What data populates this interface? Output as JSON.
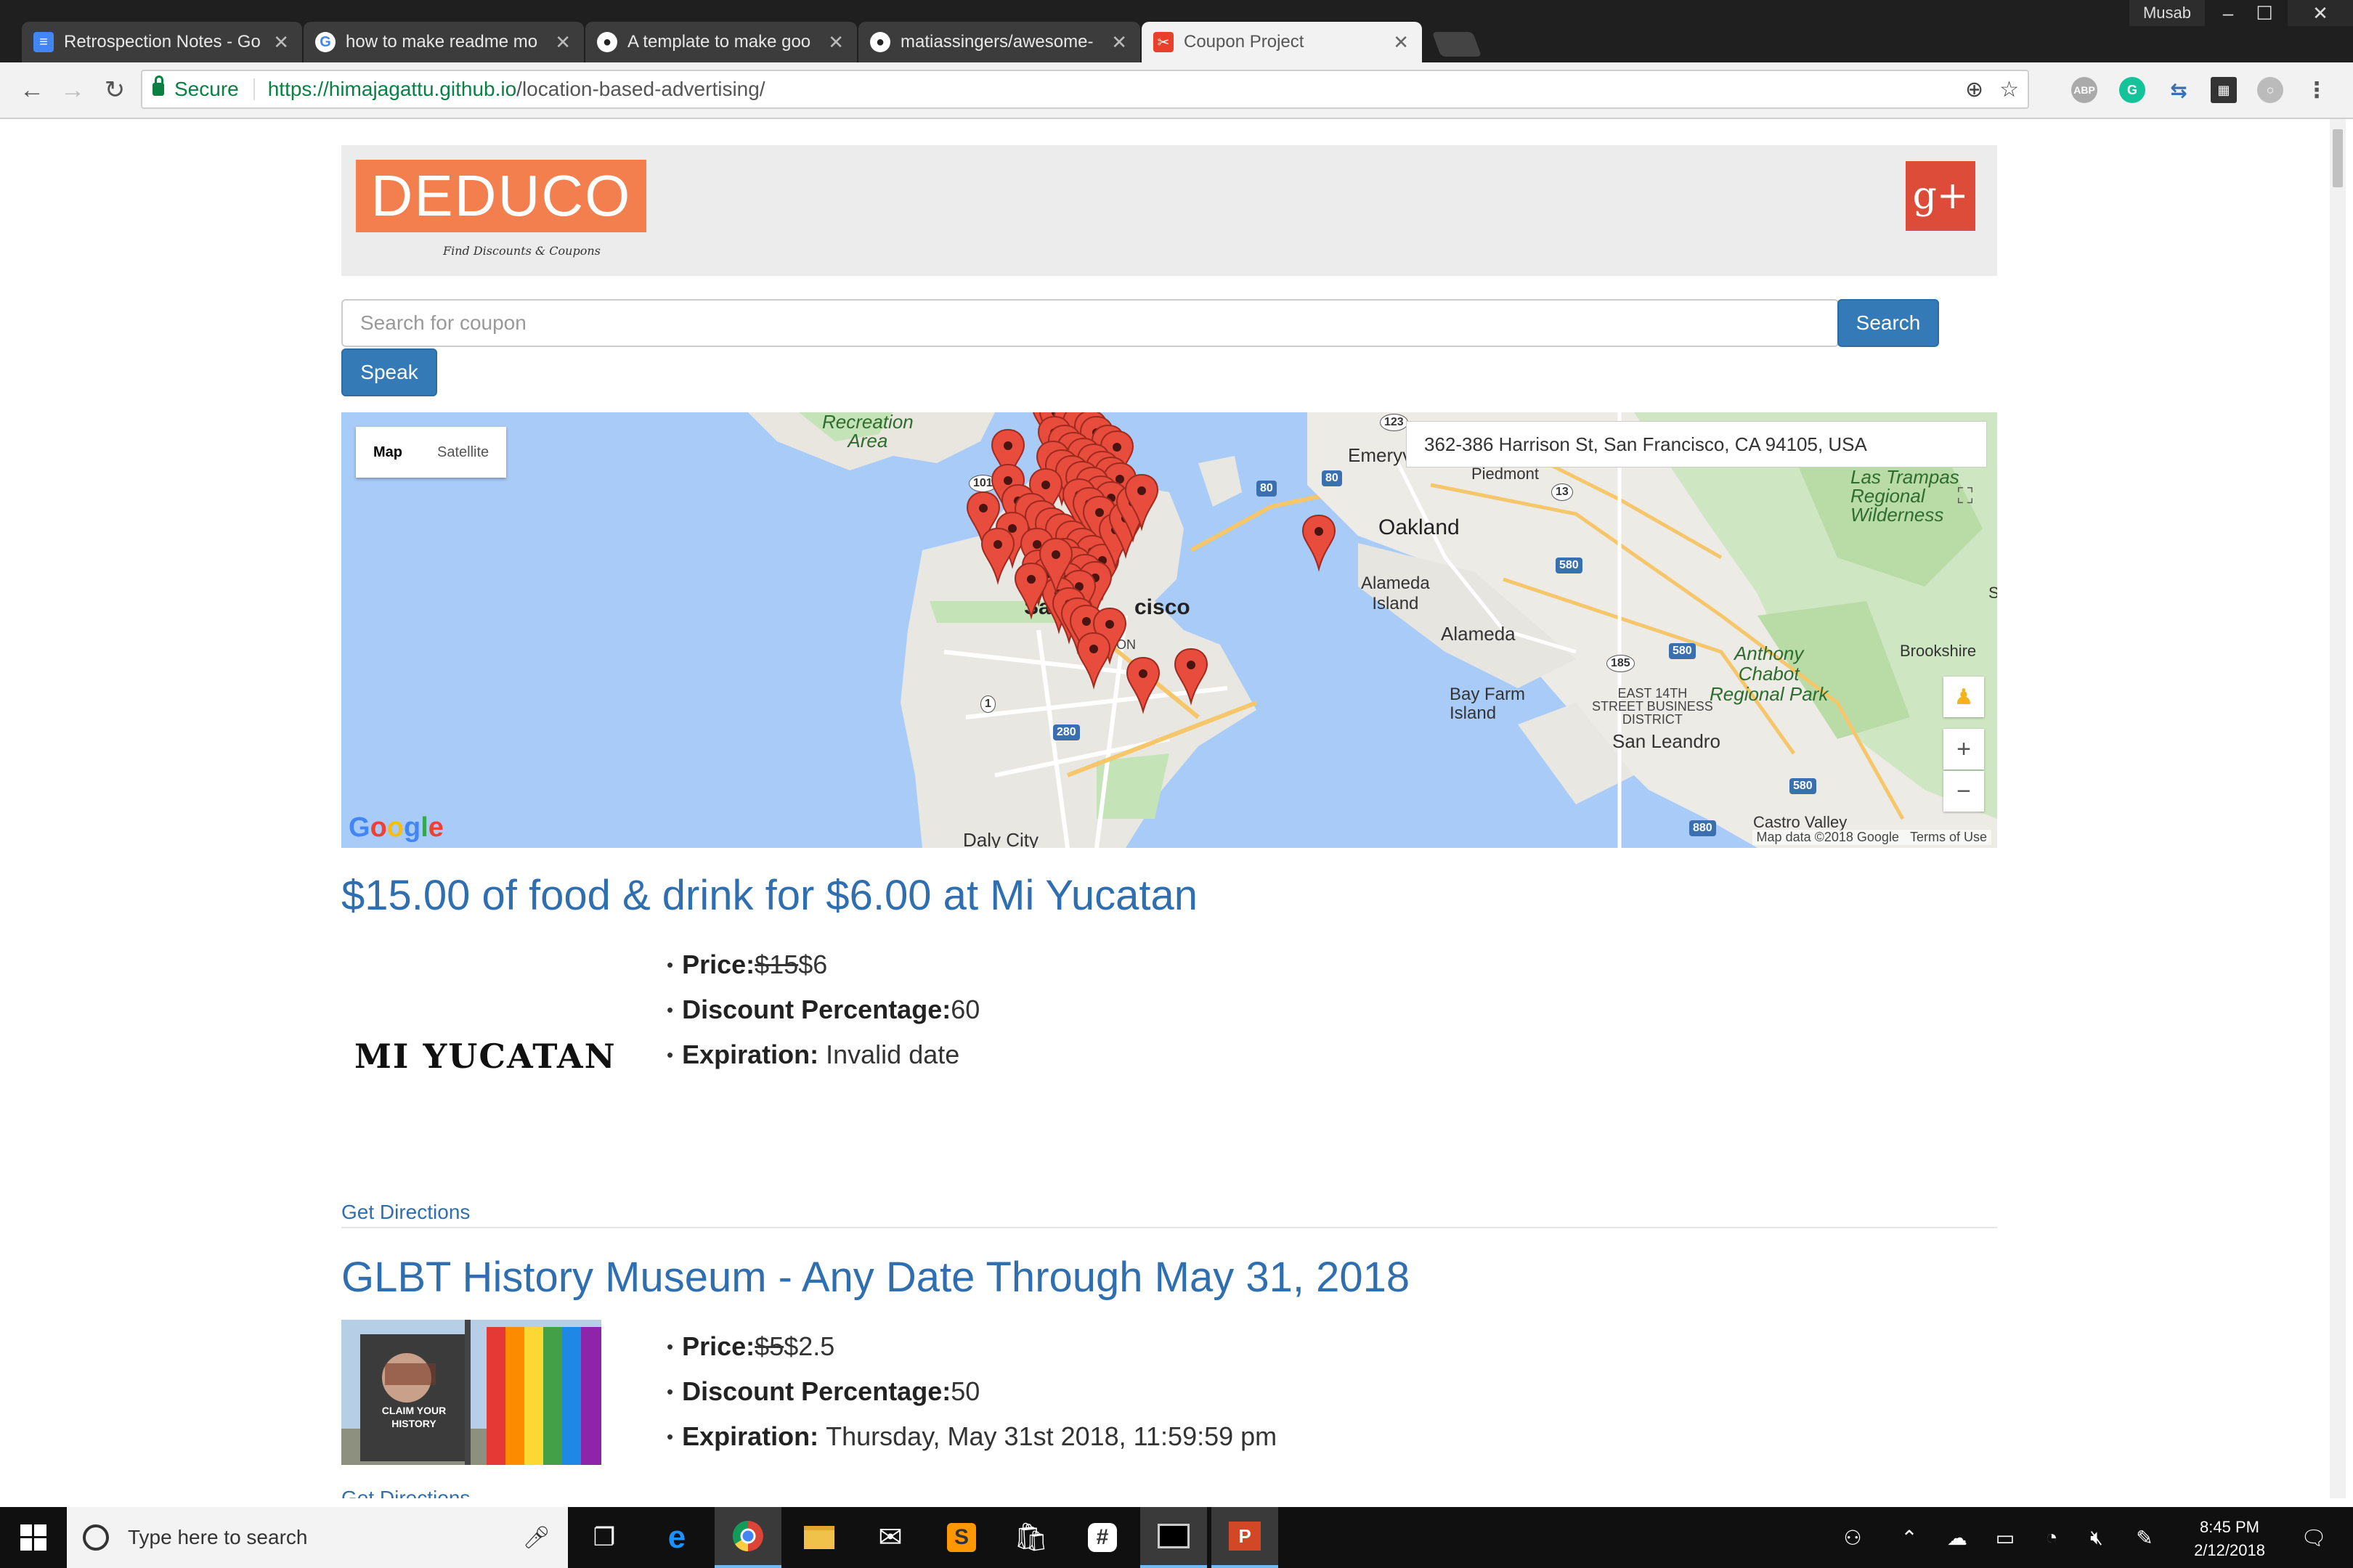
{
  "browser": {
    "user": "Musab",
    "tabs": [
      {
        "label": "Retrospection Notes - Go",
        "icon": "google-docs-icon",
        "color": "#4285f4"
      },
      {
        "label": "how to make readme mo",
        "icon": "google-icon",
        "color": "#ffffff"
      },
      {
        "label": "A template to make goo",
        "icon": "github-icon",
        "color": "#ffffff"
      },
      {
        "label": "matiassingers/awesome-",
        "icon": "github-icon",
        "color": "#ffffff"
      },
      {
        "label": "Coupon Project",
        "icon": "coupon-icon",
        "color": "#e8402b",
        "active": true
      }
    ],
    "secure_label": "Secure",
    "url_host": "https://himajagattu.github.io",
    "url_path": "/location-based-advertising/",
    "extensions": [
      "ABP",
      "G"
    ]
  },
  "page": {
    "logo_text": "DEDUCO",
    "logo_tagline": "Find Discounts & Coupons",
    "gplus_label": "g+",
    "search": {
      "placeholder": "Search for coupon",
      "button": "Search"
    },
    "speak_button": "Speak"
  },
  "map": {
    "type_map": "Map",
    "type_satellite": "Satellite",
    "address": "362-386 Harrison St, San Francisco, CA 94105, USA",
    "attribution": "Map data ©2018 Google",
    "terms": "Terms of Use",
    "google_logo": "Google",
    "labels": {
      "recreation": "Recreation\nArea",
      "emeryville": "Emeryvi",
      "piedmont": "Piedmont",
      "oakland": "Oakland",
      "alameda_island": "Alameda\nIsland",
      "alameda": "Alameda",
      "sf_left": "Sa",
      "sf_right": "cisco",
      "bay_farm": "Bay Farm\nIsland",
      "east14": "EAST 14TH\nSTREET BUSINESS\nDISTRICT",
      "san_leandro": "San Leandro",
      "las_trampas": "Las Trampas\nRegional\nWilderness",
      "anthony_chabot": "Anthony\nChabot\nRegional Park",
      "brookshire": "Brookshire",
      "daly_city": "Daly City",
      "castro_valley": "Castro Valley",
      "s": "S",
      "mission": "ION"
    },
    "shields": {
      "r123": "123",
      "r101": "101",
      "r80a": "80",
      "r80b": "80",
      "r13": "13",
      "r580a": "580",
      "r580b": "580",
      "r580c": "580",
      "r185": "185",
      "r1": "1",
      "r280": "280",
      "r880": "880"
    },
    "pin_color": "#e74c3c"
  },
  "deals": [
    {
      "title": "$15.00 of food & drink for $6.00 at Mi Yucatan",
      "logo_text": "MI YUCATAN",
      "price_label": "Price:",
      "price_old": "$15",
      "price_new": "$6",
      "discount_label": "Discount Percentage:",
      "discount": "60",
      "expiration_label": "Expiration:",
      "expiration": "Invalid date",
      "directions": "Get Directions"
    },
    {
      "title": "GLBT History Museum - Any Date Through May 31, 2018",
      "price_label": "Price:",
      "price_old": "$5",
      "price_new": "$2.5",
      "discount_label": "Discount Percentage:",
      "discount": "50",
      "expiration_label": "Expiration:",
      "expiration": "Thursday, May 31st 2018, 11:59:59 pm",
      "directions": "Get Directions",
      "image_text": "CLAIM YOUR\nHISTORY"
    }
  ],
  "taskbar": {
    "search_placeholder": "Type here to search",
    "time": "8:45 PM",
    "date": "2/12/2018"
  }
}
